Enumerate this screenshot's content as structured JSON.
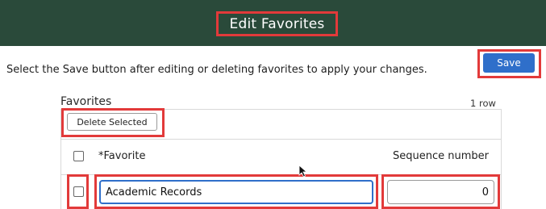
{
  "header": {
    "title": "Edit Favorites",
    "background_color": "#2a4a3a",
    "highlight_color": "#e23a3a"
  },
  "instructions": "Select the Save button after editing or deleting favorites to apply your changes.",
  "save_button": {
    "label": "Save",
    "color": "#2f6fca"
  },
  "favorites_grid": {
    "title": "Favorites",
    "row_count": "1 row",
    "toolbar": {
      "delete_selected_label": "Delete Selected"
    },
    "columns": {
      "favorite": "*Favorite",
      "sequence": "Sequence number"
    },
    "rows": [
      {
        "selected": false,
        "favorite": "Academic Records",
        "sequence": "0"
      }
    ]
  },
  "icons": {
    "cursor": "mouse-pointer-icon"
  }
}
